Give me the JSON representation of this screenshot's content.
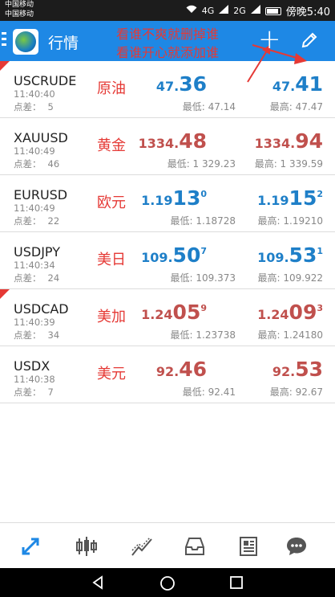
{
  "status_bar": {
    "carrier1": "中国移动",
    "carrier2": "中国移动",
    "network": "4G",
    "network2": "2G",
    "time": "傍晚5:40"
  },
  "app_bar": {
    "title": "行情",
    "overlay_line1": "看谁不爽就删掉谁",
    "overlay_line2": "看谁开心就添加谁",
    "add_label": "+"
  },
  "quotes": [
    {
      "symbol": "USCRUDE",
      "name_cn": "原油",
      "time": "11:40:40",
      "spread_label": "点差：",
      "spread": "5",
      "flag": true,
      "bid_pre": "47.",
      "bid_big": "36",
      "bid_sup": "",
      "bid_color": "blue",
      "ask_pre": "47.",
      "ask_big": "41",
      "ask_sup": "",
      "ask_color": "blue",
      "low": "最低: 47.14",
      "high": "最高: 47.47"
    },
    {
      "symbol": "XAUUSD",
      "name_cn": "黄金",
      "time": "11:40:49",
      "spread_label": "点差：",
      "spread": "46",
      "flag": false,
      "bid_pre": "1334.",
      "bid_big": "48",
      "bid_sup": "",
      "bid_color": "red",
      "ask_pre": "1334.",
      "ask_big": "94",
      "ask_sup": "",
      "ask_color": "red",
      "low": "最低: 1 329.23",
      "high": "最高: 1 339.59"
    },
    {
      "symbol": "EURUSD",
      "name_cn": "欧元",
      "time": "11:40:49",
      "spread_label": "点差：",
      "spread": "22",
      "flag": false,
      "bid_pre": "1.19",
      "bid_big": "13",
      "bid_sup": "0",
      "bid_color": "blue",
      "ask_pre": "1.19",
      "ask_big": "15",
      "ask_sup": "2",
      "ask_color": "blue",
      "low": "最低: 1.18728",
      "high": "最高: 1.19210"
    },
    {
      "symbol": "USDJPY",
      "name_cn": "美日",
      "time": "11:40:34",
      "spread_label": "点差：",
      "spread": "24",
      "flag": false,
      "bid_pre": "109.",
      "bid_big": "50",
      "bid_sup": "7",
      "bid_color": "blue",
      "ask_pre": "109.",
      "ask_big": "53",
      "ask_sup": "1",
      "ask_color": "blue",
      "low": "最低: 109.373",
      "high": "最高: 109.922"
    },
    {
      "symbol": "USDCAD",
      "name_cn": "美加",
      "time": "11:40:39",
      "spread_label": "点差：",
      "spread": "34",
      "flag": true,
      "bid_pre": "1.24",
      "bid_big": "05",
      "bid_sup": "9",
      "bid_color": "red",
      "ask_pre": "1.24",
      "ask_big": "09",
      "ask_sup": "3",
      "ask_color": "red",
      "low": "最低: 1.23738",
      "high": "最高: 1.24180"
    },
    {
      "symbol": "USDX",
      "name_cn": "美元",
      "time": "11:40:38",
      "spread_label": "点差：",
      "spread": "7",
      "flag": false,
      "bid_pre": "92.",
      "bid_big": "46",
      "bid_sup": "",
      "bid_color": "red",
      "ask_pre": "92.",
      "ask_big": "53",
      "ask_sup": "",
      "ask_color": "red",
      "low": "最低: 92.41",
      "high": "最高: 92.67"
    }
  ],
  "bottom_nav": [
    {
      "icon": "quotes-arrows-icon",
      "active": true
    },
    {
      "icon": "candlestick-chart-icon",
      "active": false
    },
    {
      "icon": "trade-trend-icon",
      "active": false
    },
    {
      "icon": "history-inbox-icon",
      "active": false
    },
    {
      "icon": "news-icon",
      "active": false
    },
    {
      "icon": "chat-bubble-icon",
      "active": false
    }
  ],
  "colors": {
    "accent": "#1e88e5",
    "bid_blue": "#1e7fc8",
    "bid_red": "#c0504d",
    "cn_label": "#e53935",
    "active_nav": "#1e88e5",
    "nav_icon": "#555555"
  }
}
